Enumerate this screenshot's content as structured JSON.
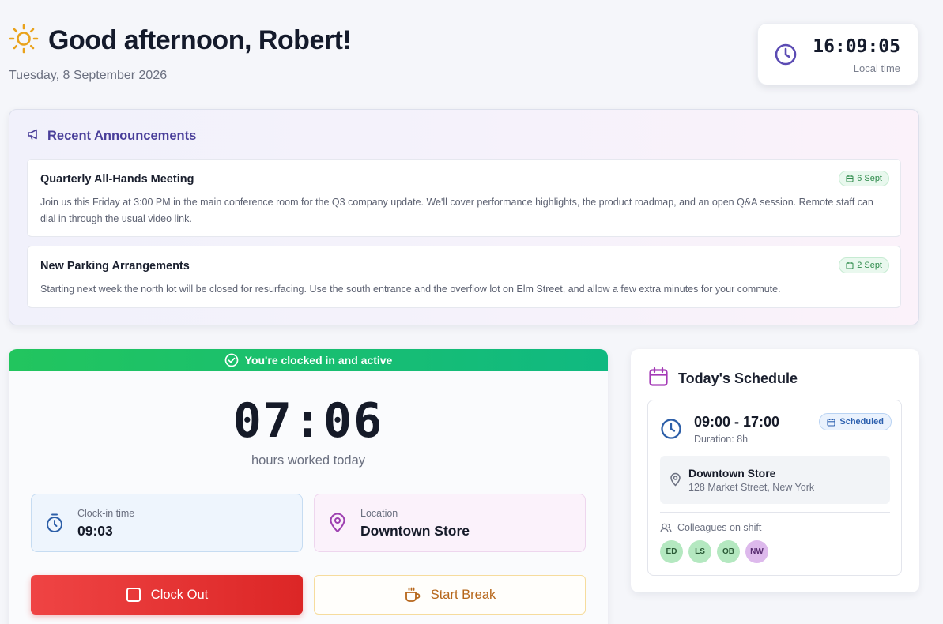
{
  "header": {
    "greeting": "Good afternoon, Robert!",
    "date": "Tuesday, 8 September 2026",
    "icon": "sun-icon"
  },
  "clock": {
    "time": "16:09:05",
    "label": "Local time"
  },
  "announcements": {
    "title": "Recent Announcements",
    "items": [
      {
        "title": "Quarterly All-Hands Meeting",
        "date": "6 Sept",
        "body": "Join us this Friday at 3:00 PM in the main conference room for the Q3 company update. We'll cover performance highlights, the product roadmap, and an open Q&A session. Remote staff can dial in through the usual video link."
      },
      {
        "title": "New Parking Arrangements",
        "date": "2 Sept",
        "body": "Starting next week the north lot will be closed for resurfacing. Use the south entrance and the overflow lot on Elm Street, and allow a few extra minutes for your commute."
      }
    ]
  },
  "work": {
    "status": "You're clocked in and active",
    "hours": "07:06",
    "hours_label": "hours worked today",
    "clock_in_label": "Clock-in time",
    "clock_in_value": "09:03",
    "location_label": "Location",
    "location_value": "Downtown Store",
    "clock_out_label": "Clock Out",
    "break_label": "Start Break"
  },
  "schedule": {
    "title": "Today's Schedule",
    "shift_time": "09:00 - 17:00",
    "duration": "Duration: 8h",
    "status": "Scheduled",
    "location_name": "Downtown Store",
    "location_address": "128 Market Street, New York",
    "colleagues_label": "Colleagues on shift",
    "colleagues": [
      "ED",
      "LS",
      "OB",
      "NW"
    ]
  },
  "colors": {
    "accent": "#4a3f9a",
    "status_green": "#22c55e",
    "clock_out_red": "#ef4444",
    "break_amber": "#b6661a"
  }
}
